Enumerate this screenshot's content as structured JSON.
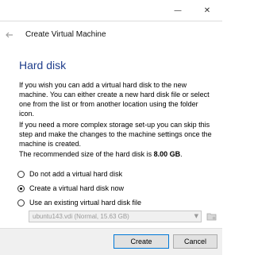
{
  "window": {
    "minimize_symbol": "—",
    "close_symbol": "✕"
  },
  "header": {
    "back_icon": "arrow-left-icon",
    "title": "Create Virtual Machine"
  },
  "page": {
    "section_title": "Hard disk",
    "paragraph1": "If you wish you can add a virtual hard disk to the new machine. You can either create a new hard disk file or select one from the list or from another location using the folder icon.",
    "paragraph2": "If you need a more complex storage set-up you can skip this step and make the changes to the machine settings once the machine is created.",
    "recommended_prefix": "The recommended size of the hard disk is ",
    "recommended_size": "8.00 GB",
    "recommended_suffix": ".",
    "options": [
      {
        "label": "Do not add a virtual hard disk",
        "checked": false
      },
      {
        "label": "Create a virtual hard disk now",
        "checked": true
      },
      {
        "label": "Use an existing virtual hard disk file",
        "checked": false
      }
    ],
    "existing_disk_select": {
      "value": "ubuntu143.vdi (Normal, 15.63 GB)",
      "disabled": true
    },
    "folder_icon": "folder-icon"
  },
  "footer": {
    "create_label": "Create",
    "cancel_label": "Cancel"
  },
  "colors": {
    "section_title": "#1f3e8c",
    "footer_bg": "#f0f0f0",
    "primary_border": "#0078d7"
  }
}
